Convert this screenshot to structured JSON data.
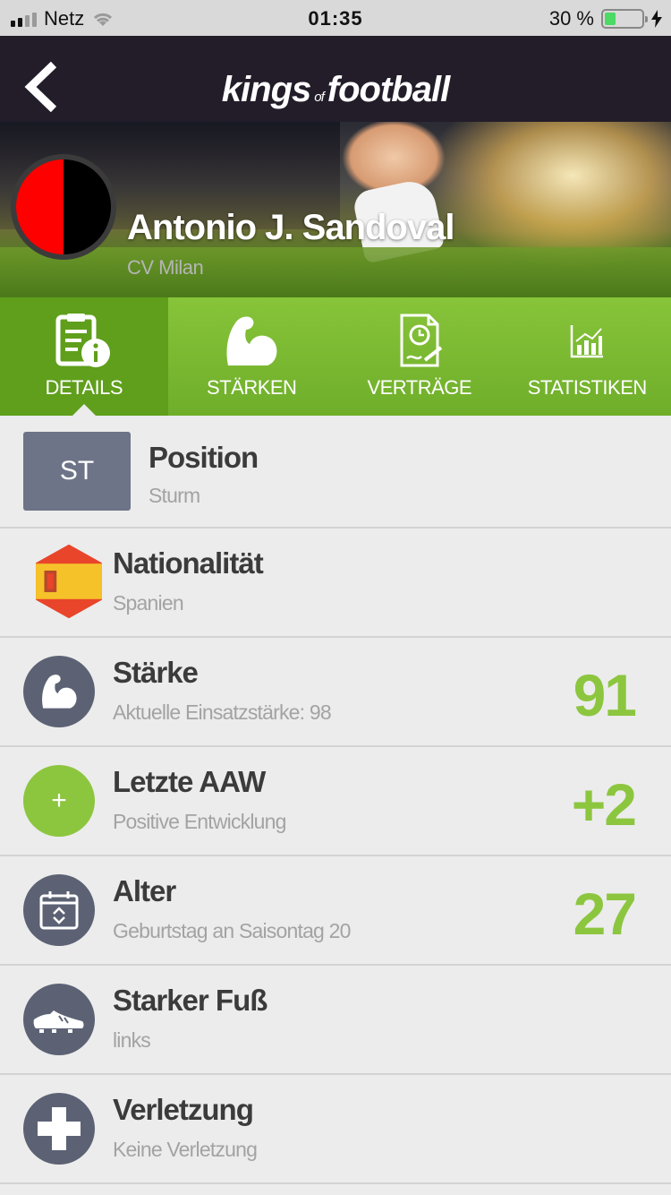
{
  "status_bar": {
    "carrier": "Netz",
    "time": "01:35",
    "battery_percent": "30 %",
    "battery_level": 0.3
  },
  "nav": {
    "logo_kings": "kings",
    "logo_of": "of",
    "logo_football": "football",
    "back_icon": "chevron-left-icon"
  },
  "player": {
    "name": "Antonio J. Sandoval",
    "club": "CV Milan",
    "club_colors": [
      "#ff0000",
      "#000000"
    ]
  },
  "tabs": [
    {
      "label": "DETAILS",
      "icon": "document-info-icon",
      "active": true
    },
    {
      "label": "STÄRKEN",
      "icon": "flexed-arm-icon",
      "active": false
    },
    {
      "label": "VERTRÄGE",
      "icon": "contract-icon",
      "active": false
    },
    {
      "label": "STATISTIKEN",
      "icon": "bar-chart-icon",
      "active": false
    }
  ],
  "details": [
    {
      "title": "Position",
      "subtitle": "Sturm",
      "badge": "ST",
      "value": ""
    },
    {
      "title": "Nationalität",
      "subtitle": "Spanien",
      "icon": "spain-flag-icon",
      "value": ""
    },
    {
      "title": "Stärke",
      "subtitle": "Aktuelle Einsatzstärke: 98",
      "icon": "flexed-arm-icon",
      "value": "91"
    },
    {
      "title": "Letzte AAW",
      "subtitle": "Positive Entwicklung",
      "icon": "plus-icon",
      "badge": "+",
      "value": "+2"
    },
    {
      "title": "Alter",
      "subtitle": "Geburtstag an Saisontag 20",
      "icon": "calendar-icon",
      "value": "27"
    },
    {
      "title": "Starker Fuß",
      "subtitle": "links",
      "icon": "football-boot-icon",
      "value": ""
    },
    {
      "title": "Verletzung",
      "subtitle": "Keine Verletzung",
      "icon": "medical-cross-icon",
      "value": ""
    }
  ],
  "colors": {
    "accent_green": "#8cc63f",
    "nav_bg": "#231d2a",
    "icon_grey": "#5c6274"
  }
}
